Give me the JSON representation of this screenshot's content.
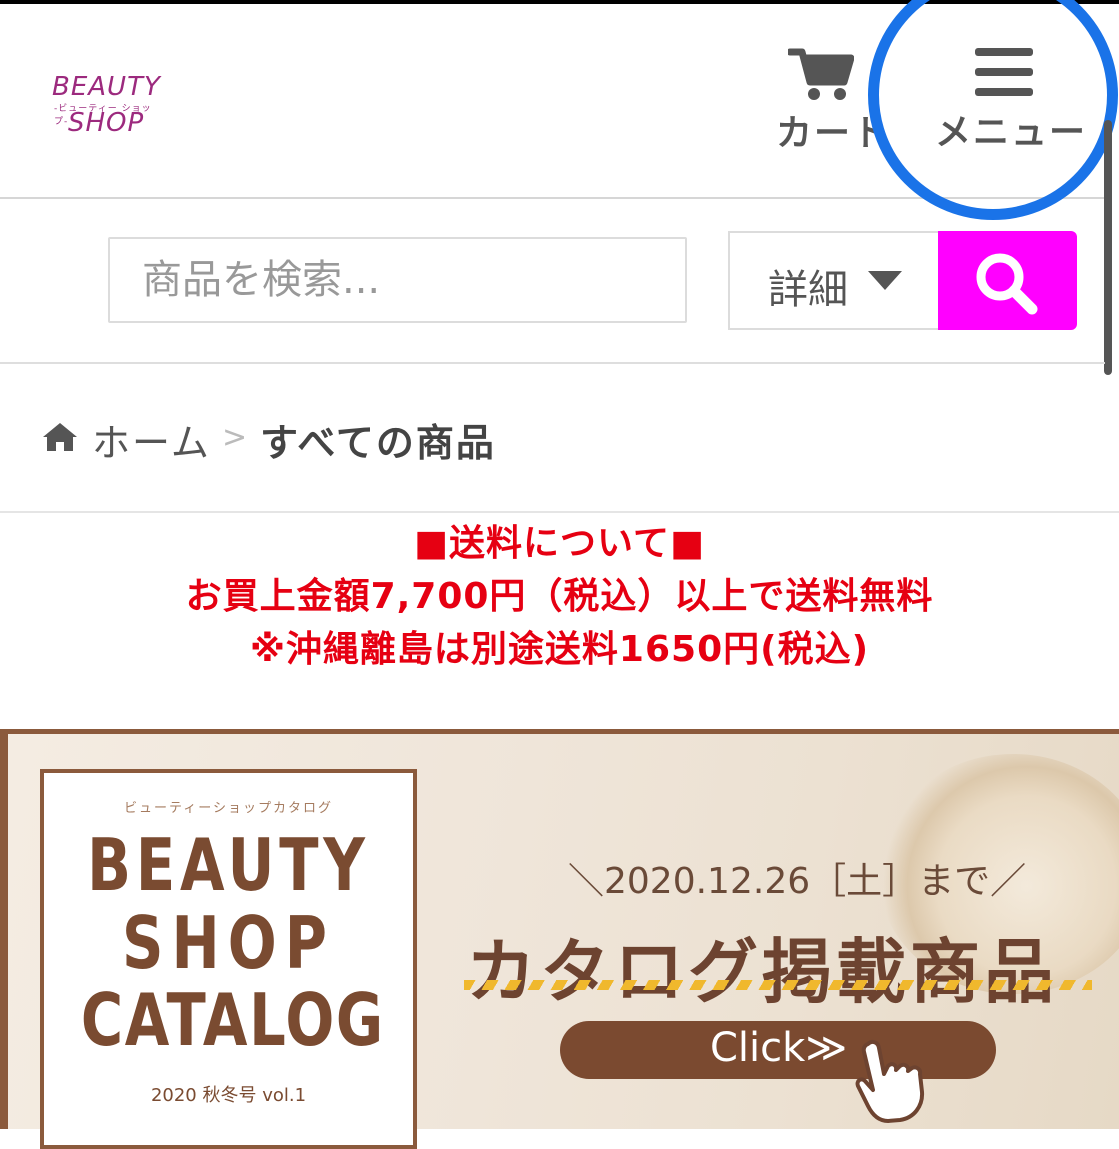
{
  "header": {
    "logo": {
      "line1": "BEAUTY",
      "line2": "-ビューティー ショップ-",
      "line3": "SHOP"
    },
    "cart_label": "カート",
    "menu_label": "メニュー"
  },
  "search": {
    "placeholder": "商品を検索...",
    "detail_label": "詳細"
  },
  "breadcrumb": {
    "home": "ホーム",
    "separator": ">",
    "current": "すべての商品"
  },
  "notice": {
    "heading": "■送料について■",
    "line1": "お買上金額7,700円（税込）以上で送料無料",
    "line2": "※沖縄離島は別途送料1650円(税込)"
  },
  "banner": {
    "catalog_sub": "ビューティーショップカタログ",
    "catalog_line1": "BEAUTY",
    "catalog_line2": "SHOP",
    "catalog_line3": "CATALOG",
    "catalog_year": "2020 秋冬号 vol.1",
    "deadline": "＼2020.12.26［土］まで／",
    "title": "カタログ掲載商品",
    "click_label": "Click≫"
  },
  "colors": {
    "accent": "#ff00ff",
    "notice_red": "#e60012",
    "highlight_blue": "#1a73e8",
    "banner_brown": "#7b4a30"
  },
  "icons": [
    "cart-icon",
    "menu-icon",
    "search-icon",
    "home-icon",
    "caret-down-icon",
    "hand-pointer-icon"
  ]
}
